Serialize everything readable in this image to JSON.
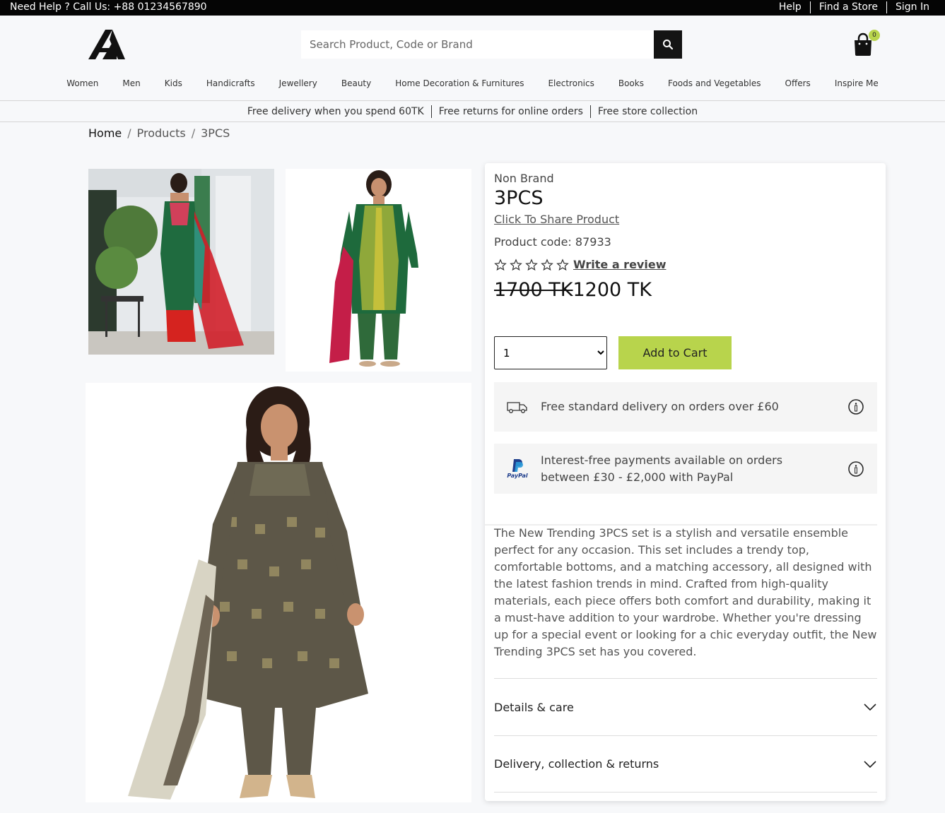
{
  "topbar": {
    "help_line": "Need Help ? Call Us: +88 01234567890",
    "links": [
      "Help",
      "Find a Store",
      "Sign In"
    ]
  },
  "header": {
    "logo_icon": "brand-logo-icon",
    "search_placeholder": "Search Product, Code or Brand",
    "cart_count": "0"
  },
  "nav": [
    "Women",
    "Men",
    "Kids",
    "Handicrafts",
    "Jewellery",
    "Beauty",
    "Home Decoration & Furnitures",
    "Electronics",
    "Books",
    "Foods and Vegetables",
    "Offers",
    "Inspire Me"
  ],
  "promo": [
    "Free delivery when you spend 60TK",
    "Free returns for online orders",
    "Free store collection"
  ],
  "breadcrumb": {
    "home": "Home",
    "products": "Products",
    "current": "3PCS",
    "separator": "/"
  },
  "product": {
    "brand": "Non Brand",
    "title": "3PCS",
    "share_label": "Click To Share Product",
    "code_label": "Product code: 87933",
    "rating_stars": 0,
    "review_label": "Write a review",
    "old_price": "1700 TK",
    "new_price": "1200 TK",
    "quantity_selected": "1",
    "add_to_cart_label": "Add to Cart",
    "delivery_info": "Free standard delivery on orders over £60",
    "paypal_info": "Interest-free payments available on orders between £30 - £2,000 with PayPal",
    "paypal_logo_text": "PayPal",
    "description": "The New Trending 3PCS set is a stylish and versatile ensemble perfect for any occasion. This set includes a trendy top, comfortable bottoms, and a matching accessory, all designed with the latest fashion trends in mind. Crafted from high-quality materials, each piece offers both comfort and durability, making it a must-have addition to your wardrobe. Whether you're dressing up for a special event or looking for a chic everyday outfit, the New Trending 3PCS set has you covered.",
    "accordions": [
      "Details & care",
      "Delivery, collection & returns"
    ]
  },
  "colors": {
    "accent": "#b8d44c",
    "topbar": "#050505",
    "background": "#f7f8fa"
  }
}
